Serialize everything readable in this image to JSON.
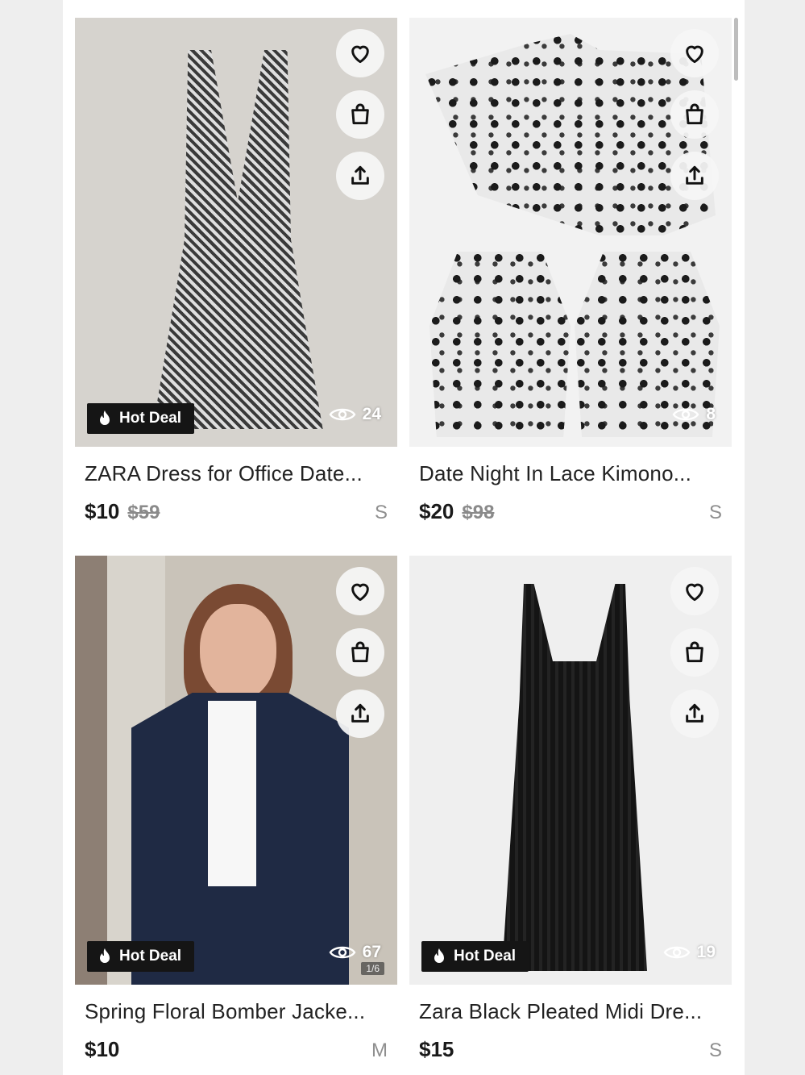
{
  "listings": [
    {
      "title": "ZARA Dress for Office Date...",
      "price": "$10",
      "original_price": "$59",
      "size": "S",
      "badge": "Hot Deal",
      "views": "24",
      "image_counter": "",
      "icons": {
        "like": "heart-icon",
        "bag": "shopping-bag-icon",
        "share": "share-icon",
        "views": "eye-icon",
        "badge": "flame-icon"
      }
    },
    {
      "title": "Date Night In Lace Kimono...",
      "price": "$20",
      "original_price": "$98",
      "size": "S",
      "badge": "",
      "views": "8",
      "image_counter": ""
    },
    {
      "title": "Spring Floral Bomber Jacke...",
      "price": "$10",
      "original_price": "",
      "size": "M",
      "badge": "Hot Deal",
      "views": "67",
      "image_counter": "1/6"
    },
    {
      "title": "Zara Black Pleated Midi Dre...",
      "price": "$15",
      "original_price": "",
      "size": "S",
      "badge": "Hot Deal",
      "views": "19",
      "image_counter": ""
    }
  ],
  "colors": {
    "badge_bg": "#151515",
    "price_text": "#1a1a1a",
    "muted_text": "#8a8a8a"
  }
}
